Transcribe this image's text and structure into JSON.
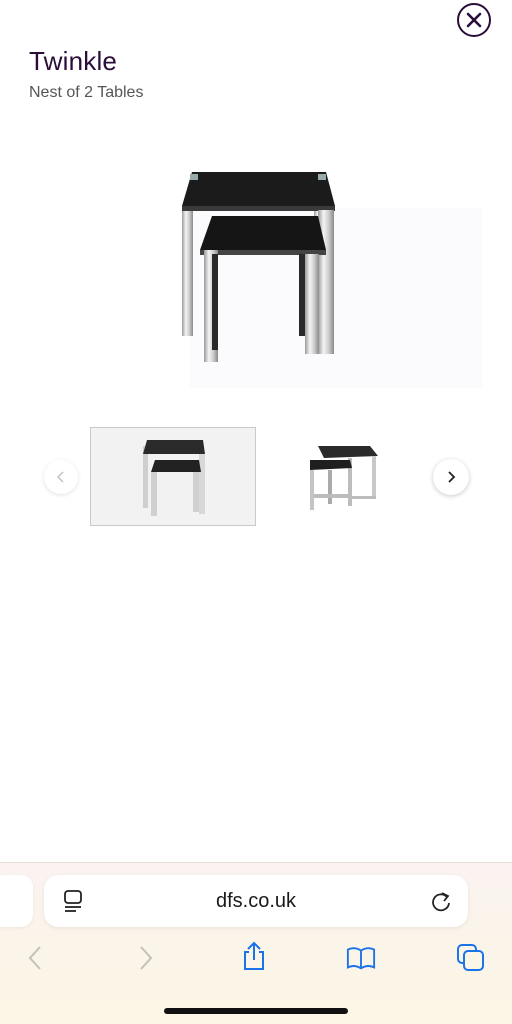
{
  "product": {
    "title": "Twinkle",
    "subtitle": "Nest of 2 Tables"
  },
  "gallery": {
    "thumbnails": [
      {
        "name": "front view",
        "selected": true
      },
      {
        "name": "angled view",
        "selected": false
      }
    ],
    "prev_icon": "chevron-left-icon",
    "next_icon": "chevron-right-icon"
  },
  "browser": {
    "url": "dfs.co.uk",
    "reader_icon": "page-menu-icon",
    "reload_icon": "reload-icon",
    "toolbar": [
      "back-icon",
      "forward-icon",
      "share-icon",
      "bookmarks-icon",
      "tabs-icon"
    ]
  },
  "colors": {
    "brand_text": "#2b0d3a",
    "link_blue": "#1a73e8"
  }
}
